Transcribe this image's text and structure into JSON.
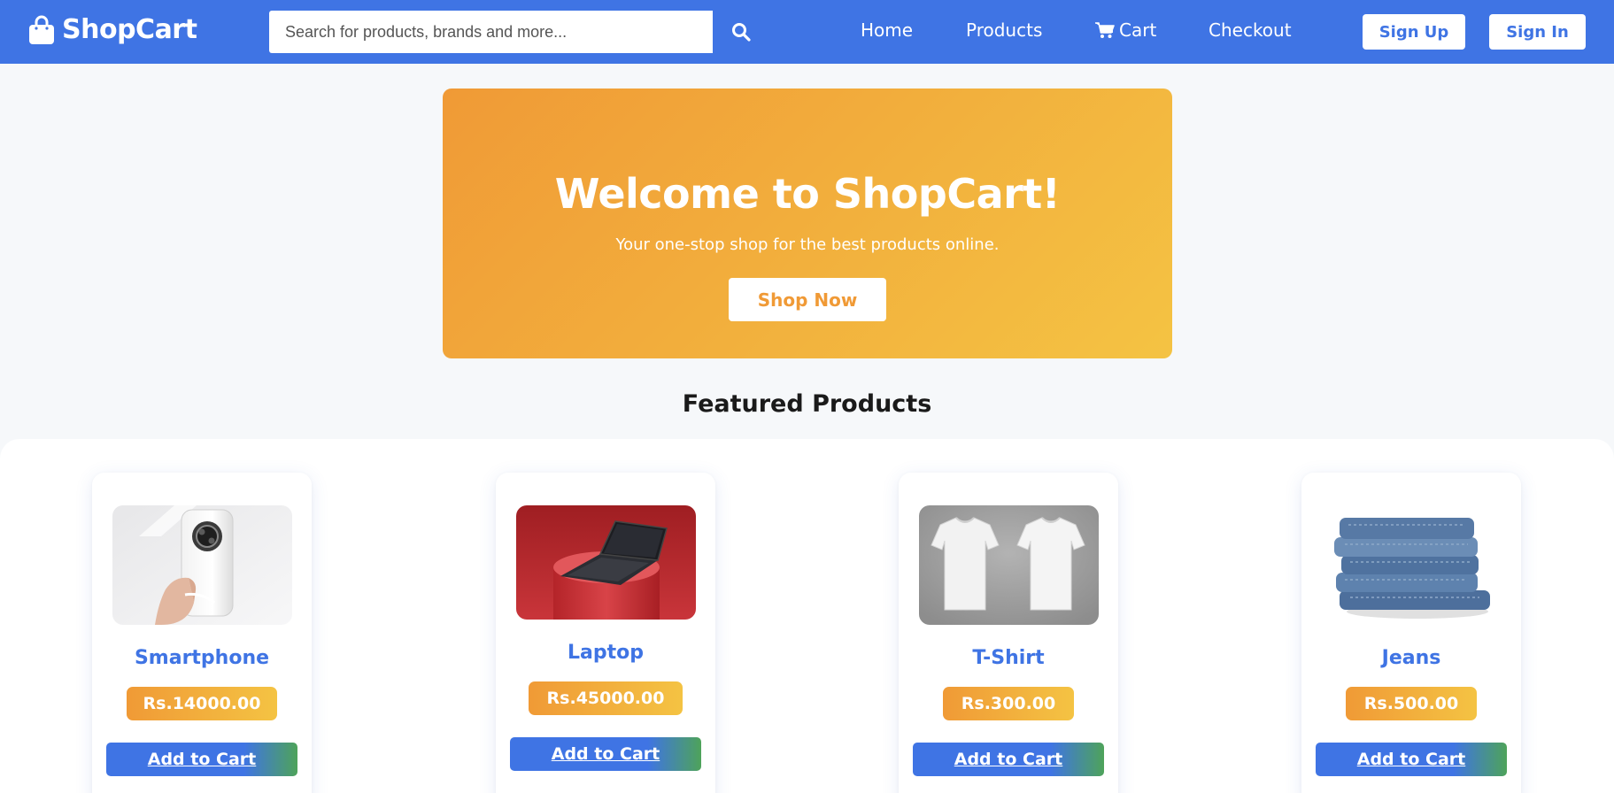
{
  "header": {
    "brand": "ShopCart",
    "search_placeholder": "Search for products, brands and more...",
    "nav": [
      "Home",
      "Products",
      "Cart",
      "Checkout"
    ],
    "signup_label": "Sign Up",
    "signin_label": "Sign In"
  },
  "hero": {
    "title": "Welcome to ShopCart!",
    "subtitle": "Your one-stop shop for the best products online.",
    "cta_label": "Shop Now"
  },
  "section_title": "Featured Products",
  "products": [
    {
      "name": "Smartphone",
      "price": "Rs.14000.00",
      "button": "Add to Cart",
      "image": "smartphone-image"
    },
    {
      "name": "Laptop",
      "price": "Rs.45000.00",
      "button": "Add to Cart",
      "image": "laptop-image"
    },
    {
      "name": "T-Shirt",
      "price": "Rs.300.00",
      "button": "Add to Cart",
      "image": "tshirt-image"
    },
    {
      "name": "Jeans",
      "price": "Rs.500.00",
      "button": "Add to Cart",
      "image": "jeans-image"
    }
  ],
  "colors": {
    "primary": "#3f74e4",
    "accent_orange": "#f09a36",
    "accent_yellow": "#f4c343",
    "accent_green": "#4ea35a"
  }
}
